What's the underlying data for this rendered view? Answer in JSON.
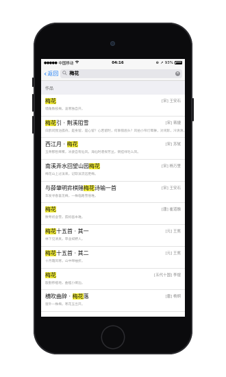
{
  "status_bar": {
    "carrier": "中国移动",
    "time": "04:16",
    "battery": "93%",
    "battery_level": 0.93
  },
  "nav": {
    "back_label": "返回",
    "search_value": "梅花"
  },
  "section_title": "作品",
  "results": [
    {
      "pre": "",
      "hl": "梅花",
      "post": "",
      "author": "[宋] 王安石",
      "excerpt": "墙角数枝梅，凌寒独自开。"
    },
    {
      "pre": "",
      "hl": "梅花",
      "post": "引 · 荆溪阻雪",
      "author": "[宋] 蒋捷",
      "excerpt": "白鸥问我泊孤舟，是身留，是心留？心若留时，何事锁眉头？风拍小帘灯晕舞，对闲影，冷清清，忆旧游。"
    },
    {
      "pre": "西江月 · ",
      "hl": "梅花",
      "post": "",
      "author": "[宋] 苏轼",
      "excerpt": "玉骨那愁瘴雾，冰姿自有仙风。海仙时遣探芳丛，倒挂绿毛么凤。"
    },
    {
      "pre": "南溪弄水回望山园",
      "hl": "梅花",
      "post": "",
      "author": "[宋] 杨万里",
      "excerpt": "梅花山上过溪来，记取溪流远更梅。"
    },
    {
      "pre": "与薛肇明弈棋赌",
      "hl": "梅花",
      "post": "诗输一首",
      "author": "[宋] 王安石",
      "excerpt": "华发寻春喜见梅，一株临路雪倍堆。"
    },
    {
      "pre": "",
      "hl": "梅花",
      "post": "",
      "author": "[唐] 崔道融",
      "excerpt": "数萼初含雪，孤标画本难。"
    },
    {
      "pre": "",
      "hl": "梅花",
      "post": "十五首 · 其一",
      "author": "[元] 王冕",
      "excerpt": "林下见清真，草含如野人。"
    },
    {
      "pre": "",
      "hl": "梅花",
      "post": "十五首 · 其二",
      "author": "[元] 王冕",
      "excerpt": "十月霜风寒，山中绵袖折。"
    },
    {
      "pre": "",
      "hl": "梅花",
      "post": "",
      "author": "[五代十国] 李煜",
      "excerpt": "殷勤移植地，曲槛小阑边。"
    },
    {
      "pre": "横吹曲辞 · ",
      "hl": "梅花",
      "post": "落",
      "author": "[唐] 杨炯",
      "excerpt": "窗外一株梅，寒花五出开。"
    }
  ]
}
